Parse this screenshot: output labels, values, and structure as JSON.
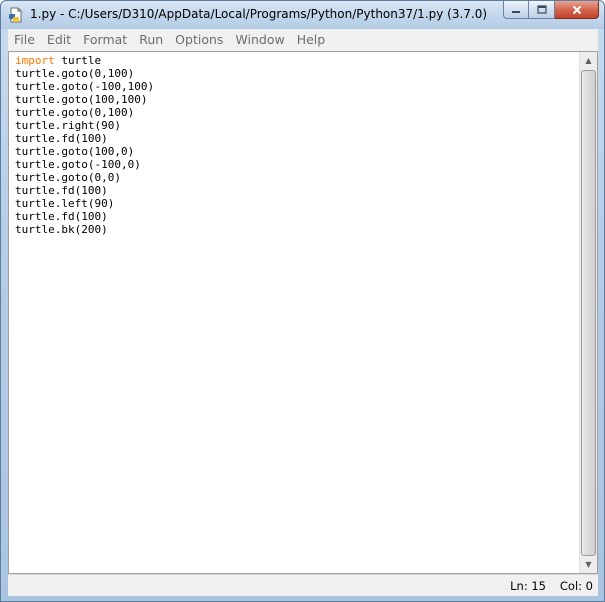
{
  "window": {
    "title": "1.py - C:/Users/D310/AppData/Local/Programs/Python/Python37/1.py (3.7.0)",
    "icons": {
      "app": "python-file-icon",
      "minimize": "minimize-icon",
      "maximize": "maximize-icon",
      "close": "close-icon"
    }
  },
  "menu": {
    "items": [
      "File",
      "Edit",
      "Format",
      "Run",
      "Options",
      "Window",
      "Help"
    ]
  },
  "editor": {
    "keyword": "import",
    "first_line_rest": " turtle",
    "lines": [
      "turtle.goto(0,100)",
      "turtle.goto(-100,100)",
      "turtle.goto(100,100)",
      "turtle.goto(0,100)",
      "turtle.right(90)",
      "turtle.fd(100)",
      "turtle.goto(100,0)",
      "turtle.goto(-100,0)",
      "turtle.goto(0,0)",
      "turtle.fd(100)",
      "turtle.left(90)",
      "turtle.fd(100)",
      "turtle.bk(200)"
    ],
    "keyword_color": "#ff7700"
  },
  "status": {
    "line": "Ln: 15",
    "col": "Col: 0"
  }
}
